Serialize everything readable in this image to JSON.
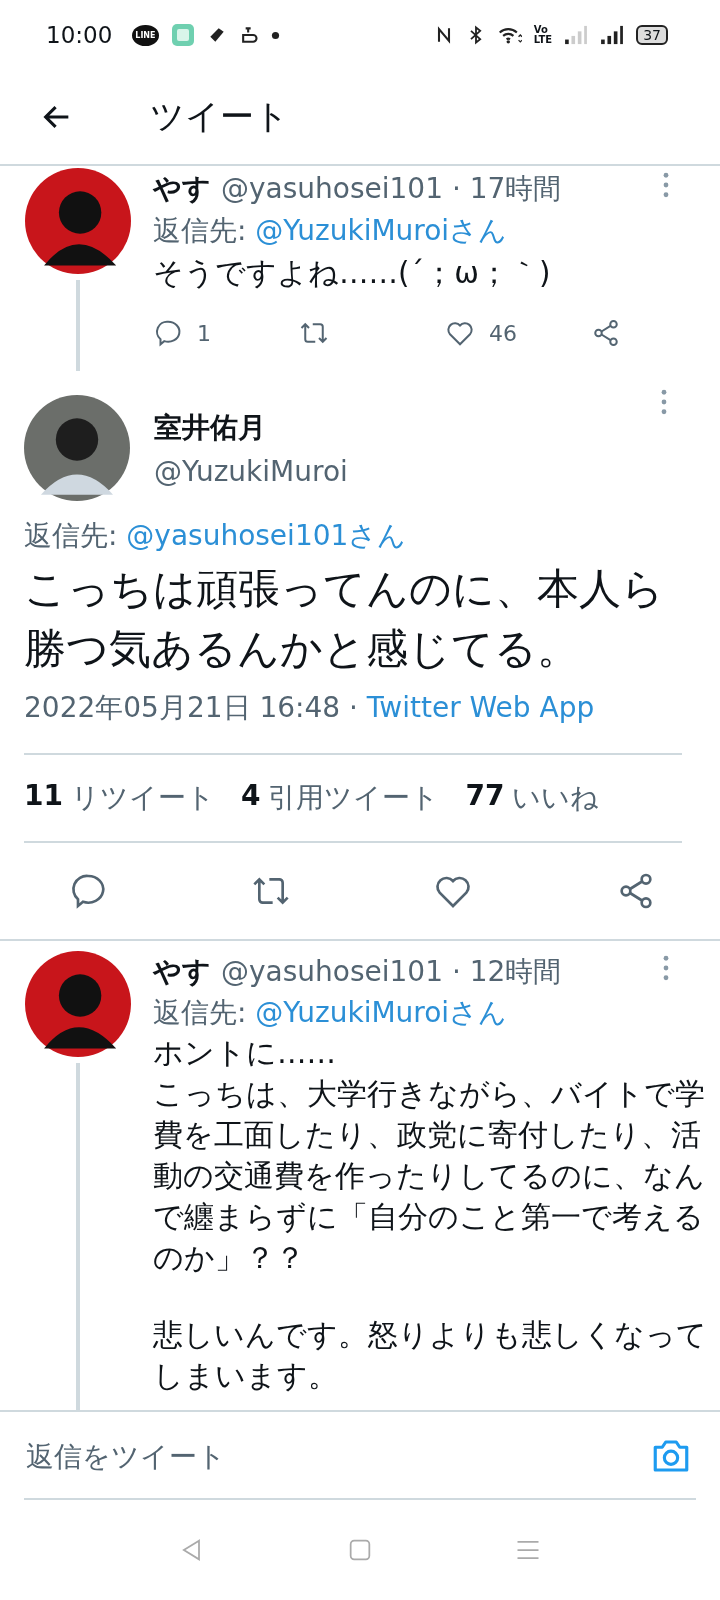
{
  "status_bar": {
    "time": "10:00",
    "line_label": "LINE",
    "volte_top": "Vo",
    "volte_bottom": "LTE",
    "battery": "37"
  },
  "header": {
    "title": "ツイート"
  },
  "replies_before": [
    {
      "name": "やす",
      "handle": "@yasuhosei101 · 17時間",
      "reply_prefix": "返信先: ",
      "reply_to": "@YuzukiMuroiさん",
      "text": "そうですよね……(´；ω；｀)",
      "actions": [
        {
          "kind": "reply",
          "count": "1"
        },
        {
          "kind": "retweet"
        },
        {
          "kind": "like",
          "count": "46"
        },
        {
          "kind": "share"
        }
      ]
    }
  ],
  "main_tweet": {
    "name": "室井佑月",
    "handle": "@YuzukiMuroi",
    "reply_prefix": "返信先: ",
    "reply_to": "@yasuhosei101さん",
    "text": "こっちは頑張ってんのに、本人ら勝つ気あるんかと感じてる。",
    "date": "2022年05月21日 16:48 · ",
    "source": "Twitter Web App",
    "stats": [
      {
        "count": "11",
        "label": "リツイート"
      },
      {
        "count": "4",
        "label": "引用ツイート"
      },
      {
        "count": "77",
        "label": "いいね"
      }
    ],
    "actions": [
      {
        "kind": "reply"
      },
      {
        "kind": "retweet"
      },
      {
        "kind": "like"
      },
      {
        "kind": "share"
      }
    ]
  },
  "replies_after": [
    {
      "name": "やす",
      "handle": "@yasuhosei101 · 12時間",
      "reply_prefix": "返信先: ",
      "reply_to": "@YuzukiMuroiさん",
      "paragraphs": [
        [
          "ホントに……",
          "こっちは、大学行きながら、バイトで学費を工面したり、政党に寄付したり、活動の交通費を作ったりしてるのに、なんで纏まらずに「自分のこと第一で考えるのか」？？"
        ],
        [
          "悲しいんです。怒りよりも悲しくなってしまいます。"
        ]
      ]
    }
  ],
  "reply_bar": {
    "placeholder": "返信をツイート"
  }
}
